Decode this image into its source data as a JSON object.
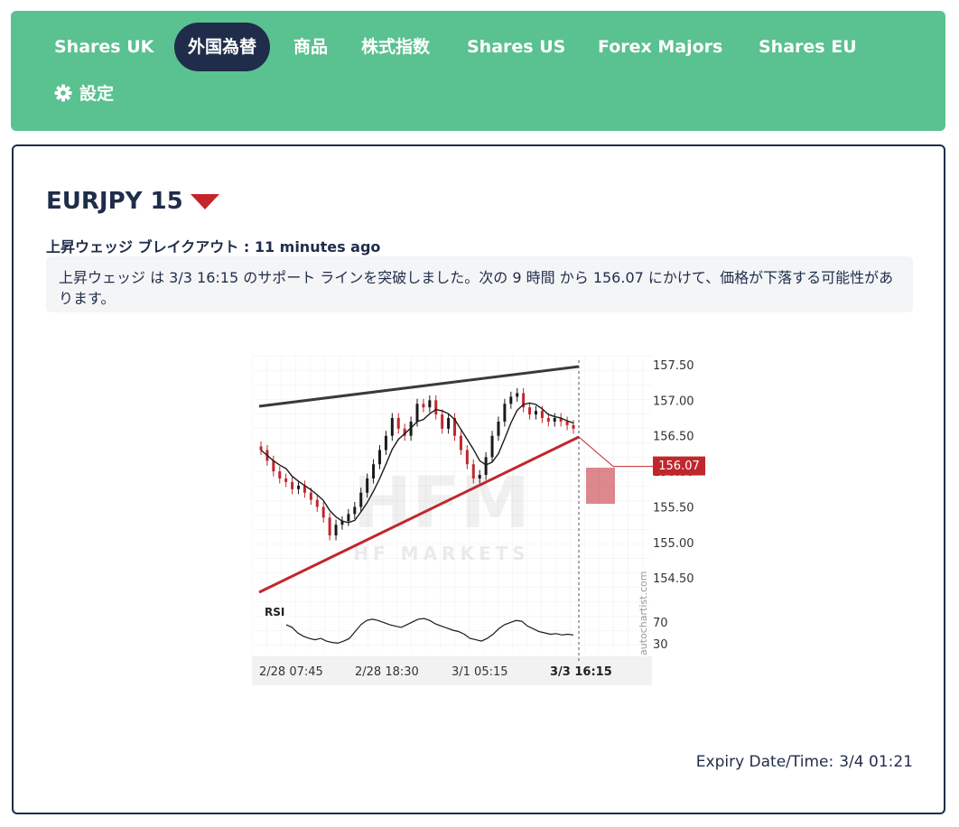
{
  "nav": {
    "tabs": [
      {
        "label": "Shares UK",
        "active": false
      },
      {
        "label": "外国為替",
        "active": true
      },
      {
        "label": "商品",
        "active": false
      },
      {
        "label": "株式指数",
        "active": false
      },
      {
        "label": "Shares US",
        "active": false
      },
      {
        "label": "Forex Majors",
        "active": false
      },
      {
        "label": "Shares EU",
        "active": false
      }
    ],
    "settings_label": "設定"
  },
  "signal": {
    "symbol": "EURJPY 15",
    "direction": "down",
    "pattern": "上昇ウェッジ ブレイクアウト",
    "age": ": 11 minutes ago",
    "description": "上昇ウェッジ は 3/3 16:15 のサポート ラインを突破しました。次の 9 時間 から 156.07 にかけて、価格が下落する可能性があります。",
    "expiry_label": "Expiry Date/Time:",
    "expiry_value": "3/4 01:21"
  },
  "chart_data": {
    "type": "line",
    "watermark": "HFM",
    "watermark_sub": "HF MARKETS",
    "credit": "autochartist.com",
    "rsi_label": "RSI",
    "rsi_ticks": [
      "70",
      "30"
    ],
    "y_ticks": [
      "157.50",
      "157.00",
      "156.50",
      "156.00",
      "155.50",
      "155.00",
      "154.50"
    ],
    "x_ticks": [
      "2/28 07:45",
      "2/28 18:30",
      "3/1 05:15",
      "3/3 16:15"
    ],
    "target_label": "156.07",
    "target": 156.07,
    "ylim": [
      154.3,
      157.55
    ],
    "colors": {
      "up": "#1a1a1a",
      "down": "#c0272d",
      "support": "#c0272d",
      "resistance": "#3a3a3a",
      "target": "#c0272d"
    },
    "close": [
      156.3,
      156.15,
      156.0,
      155.9,
      155.85,
      155.75,
      155.8,
      155.7,
      155.6,
      155.5,
      155.35,
      155.1,
      155.25,
      155.3,
      155.4,
      155.5,
      155.7,
      155.9,
      156.1,
      156.3,
      156.5,
      156.75,
      156.6,
      156.5,
      156.7,
      156.95,
      156.9,
      157.0,
      156.8,
      156.6,
      156.75,
      156.5,
      156.3,
      156.1,
      155.9,
      155.95,
      156.2,
      156.5,
      156.7,
      156.95,
      157.05,
      157.1,
      156.9,
      156.8,
      156.85,
      156.75,
      156.7,
      156.75,
      156.7,
      156.65,
      156.6
    ],
    "rsi": [
      62,
      58,
      50,
      45,
      42,
      40,
      42,
      38,
      36,
      35,
      38,
      42,
      52,
      62,
      68,
      70,
      68,
      65,
      62,
      60,
      58,
      62,
      66,
      70,
      71,
      68,
      63,
      60,
      57,
      54,
      52,
      48,
      42,
      40,
      38,
      42,
      48,
      56,
      62,
      65,
      68,
      67,
      60,
      56,
      52,
      50,
      48,
      49,
      47,
      48,
      47
    ]
  }
}
